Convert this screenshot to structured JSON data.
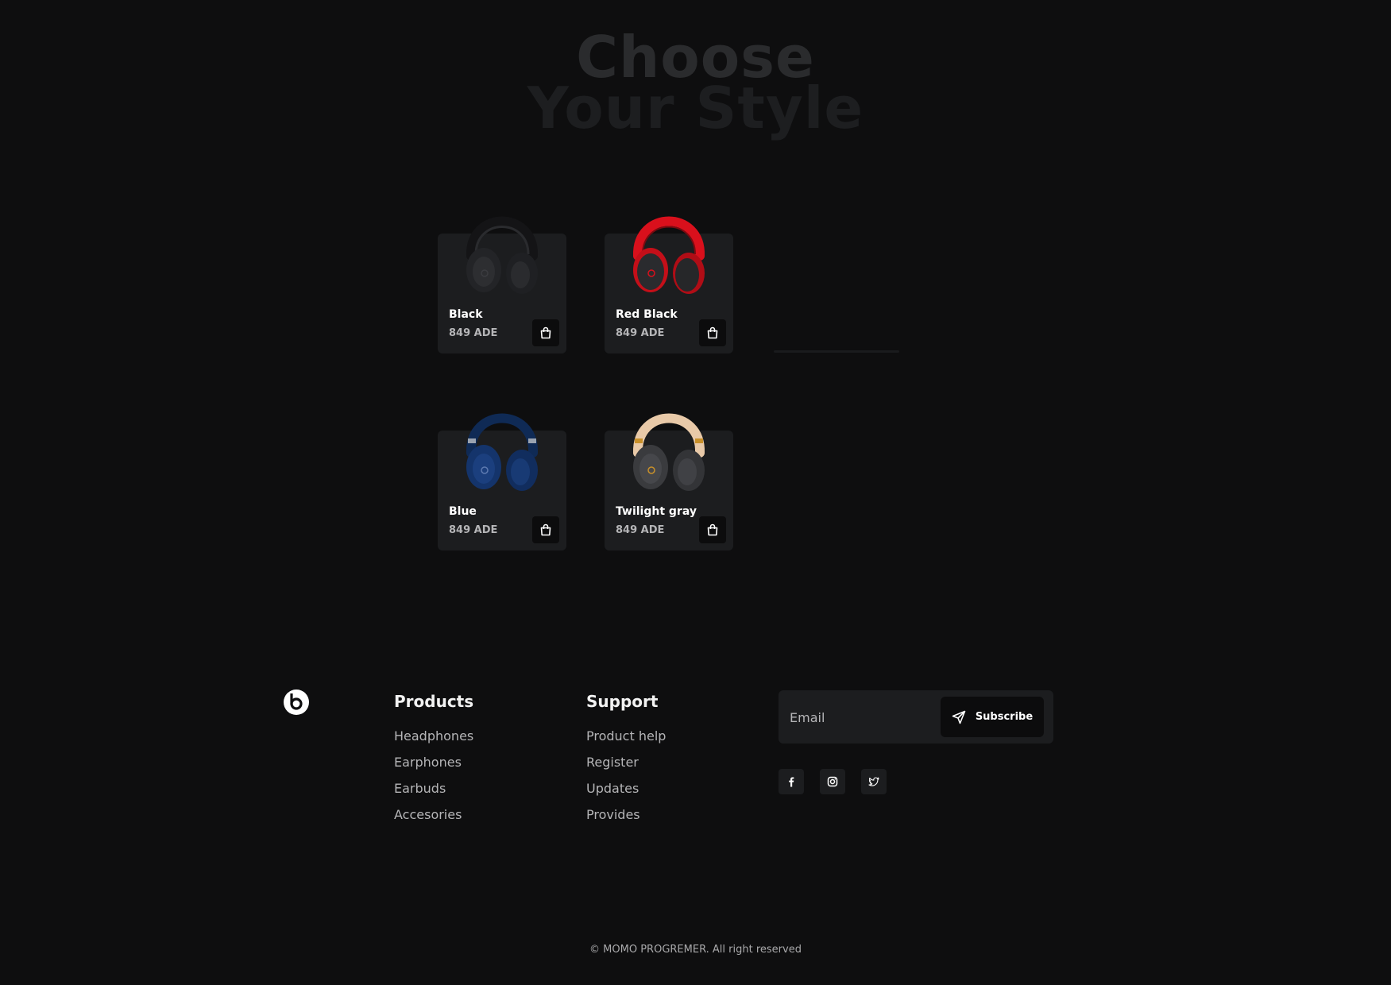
{
  "heading": {
    "line1": "Choose",
    "line2": "Your Style"
  },
  "products": [
    {
      "name": "Black",
      "price": "849 ADE",
      "color": "black"
    },
    {
      "name": "Red Black",
      "price": "849 ADE",
      "color": "red-black"
    },
    {
      "name": "Blue",
      "price": "849 ADE",
      "color": "blue"
    },
    {
      "name": "Twilight gray",
      "price": "849 ADE",
      "color": "twilight-gray"
    }
  ],
  "footer": {
    "products_title": "Products",
    "products_links": [
      "Headphones",
      "Earphones",
      "Earbuds",
      "Accesories"
    ],
    "support_title": "Support",
    "support_links": [
      "Product help",
      "Register",
      "Updates",
      "Provides"
    ],
    "email_placeholder": "Email",
    "subscribe_label": "Subscribe",
    "social_icons": [
      "facebook-icon",
      "instagram-icon",
      "twitter-icon"
    ],
    "copyright": "© MOMO PROGREMER. All right reserved"
  },
  "colors": {
    "background": "#0e0e0f",
    "card": "#1c1d1f",
    "button": "#0c0c0d",
    "muted_text": "#b5b5b7"
  }
}
